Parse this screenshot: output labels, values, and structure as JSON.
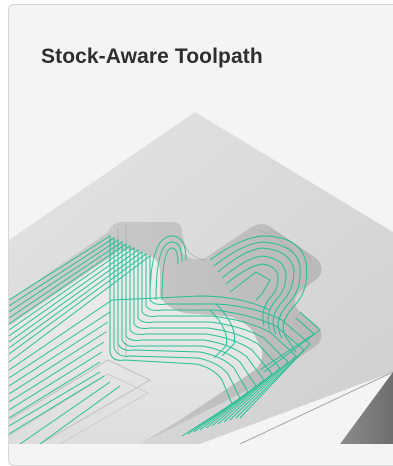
{
  "card": {
    "title": "Stock-Aware Toolpath"
  },
  "illustration": {
    "icon": "machined-pocket-toolpath-illustration",
    "toolpath_color": "#1fbf92",
    "part_color": "#d9d9d9"
  }
}
